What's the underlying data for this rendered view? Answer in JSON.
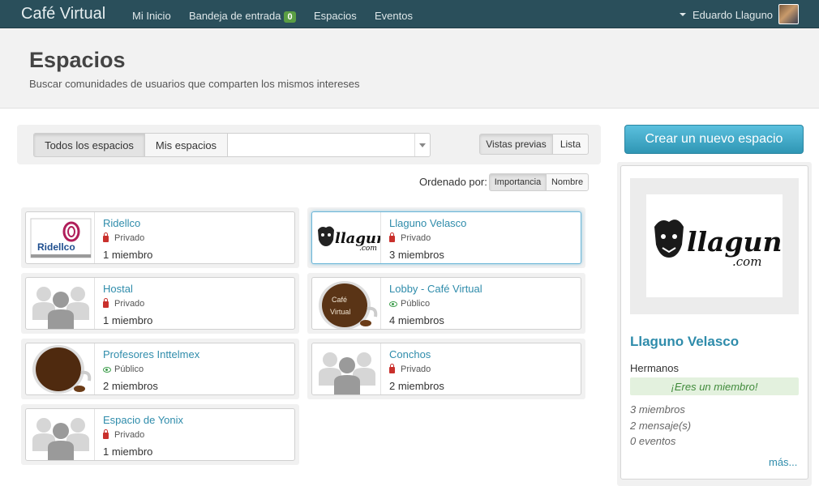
{
  "navbar": {
    "brand": "Café Virtual",
    "links": {
      "home": "Mi Inicio",
      "inbox": "Bandeja de entrada",
      "inbox_count": "0",
      "spaces": "Espacios",
      "events": "Eventos"
    },
    "user_name": "Eduardo Llaguno"
  },
  "header": {
    "title": "Espacios",
    "subtitle": "Buscar comunidades de usuarios que comparten los mismos intereses"
  },
  "filters": {
    "all_spaces": "Todos los espacios",
    "my_spaces": "Mis espacios",
    "search_value": "",
    "view_preview": "Vistas previas",
    "view_list": "Lista"
  },
  "sort": {
    "label": "Ordenado por:",
    "importance": "Importancia",
    "name": "Nombre"
  },
  "spaces": [
    {
      "name": "Ridellco",
      "access": "Privado",
      "members": "1 miembro",
      "thumb": "ridellco-logo"
    },
    {
      "name": "Llaguno Velasco",
      "access": "Privado",
      "members": "3 miembros",
      "thumb": "llaguno-logo"
    },
    {
      "name": "Hostal",
      "access": "Privado",
      "members": "1 miembro",
      "thumb": "group-placeholder"
    },
    {
      "name": "Lobby - Café Virtual",
      "access": "Público",
      "members": "4 miembros",
      "thumb": "coffee-cup-labeled"
    },
    {
      "name": "Profesores Inttelmex",
      "access": "Público",
      "members": "2 miembros",
      "thumb": "coffee-cup"
    },
    {
      "name": "Conchos",
      "access": "Privado",
      "members": "2 miembros",
      "thumb": "group-placeholder"
    },
    {
      "name": "Espacio de Yonix",
      "access": "Privado",
      "members": "1 miembro",
      "thumb": "group-placeholder"
    }
  ],
  "thumb_text": {
    "ridellco": "Ridellco",
    "cafe_line1": "Café",
    "cafe_line2": "Virtual",
    "llaguno": "llaguno",
    "llaguno_com": ".com"
  },
  "sidebar": {
    "create_button": "Crear un nuevo espacio",
    "selected_title": "Llaguno Velasco",
    "selected_desc": "Hermanos",
    "member_notice": "¡Eres un miembro!",
    "stat_members": "3 miembros",
    "stat_messages": "2 mensaje(s)",
    "stat_events": "0 eventos",
    "more": "más..."
  },
  "colors": {
    "navbar": "#2a4f5b",
    "link": "#2f8cab",
    "private": "#c9302c",
    "public": "#3c9d4a",
    "create_button": "#3aa7cc"
  }
}
